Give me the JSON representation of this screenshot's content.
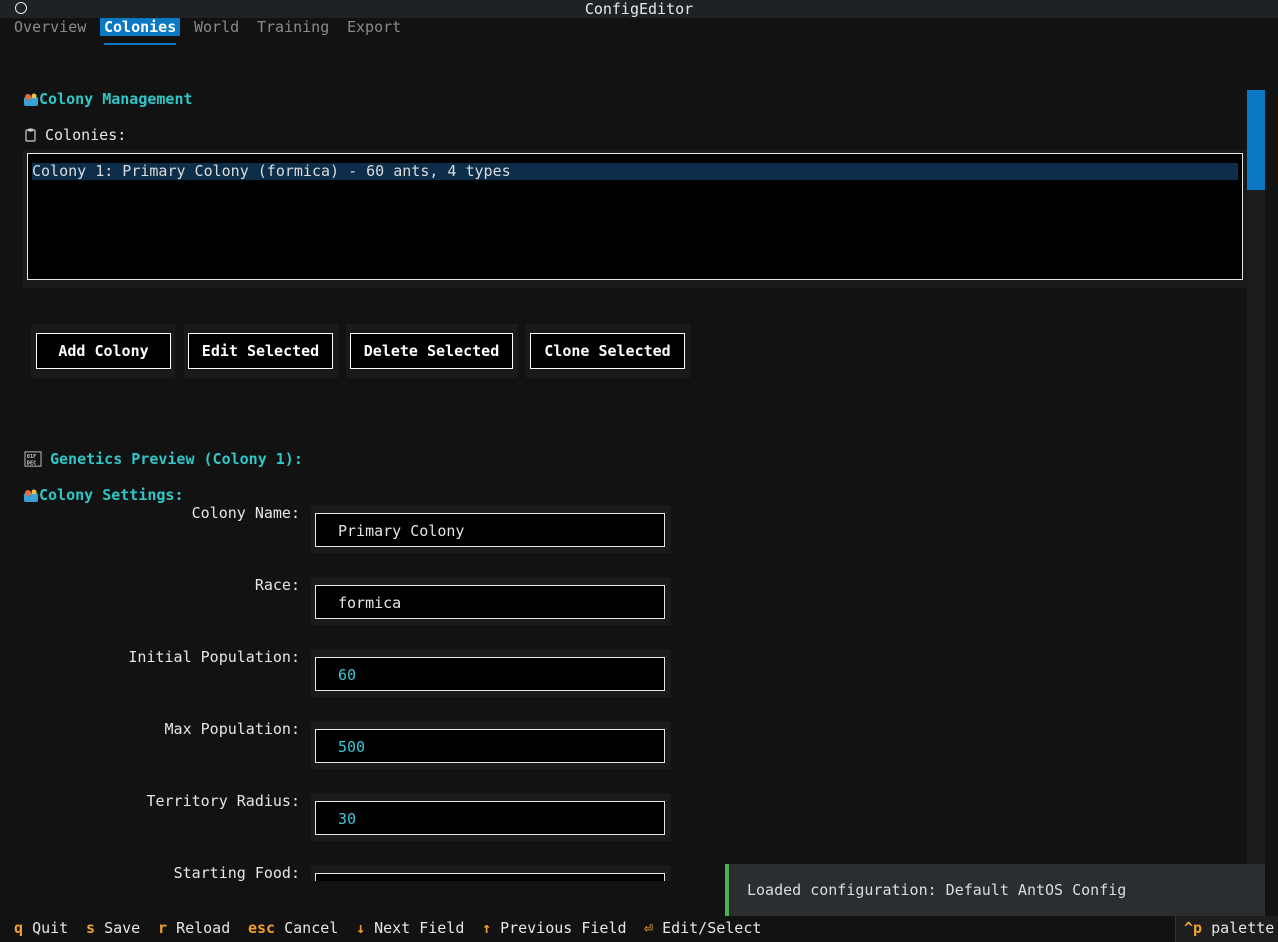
{
  "window": {
    "title": "ConfigEditor"
  },
  "tabs": [
    {
      "label": "Overview"
    },
    {
      "label": "Colonies"
    },
    {
      "label": "World"
    },
    {
      "label": "Training"
    },
    {
      "label": "Export"
    }
  ],
  "colony_management": {
    "title": "Colony Management",
    "list_label": "Colonies:",
    "items": [
      "Colony 1: Primary Colony (formica) - 60 ants, 4 types"
    ],
    "buttons": {
      "add": "Add Colony",
      "edit": "Edit Selected",
      "delete": "Delete Selected",
      "clone": "Clone Selected"
    }
  },
  "genetics_preview": {
    "title": "Genetics Preview (Colony 1):"
  },
  "colony_settings": {
    "title": "Colony Settings:",
    "fields": [
      {
        "label": "Colony Name:",
        "value": "Primary Colony"
      },
      {
        "label": "Race:",
        "value": "formica"
      },
      {
        "label": "Initial Population:",
        "value": "60"
      },
      {
        "label": "Max Population:",
        "value": "500"
      },
      {
        "label": "Territory Radius:",
        "value": "30"
      },
      {
        "label": "Starting Food:",
        "value": ""
      }
    ]
  },
  "toast": {
    "message": "Loaded configuration: Default AntOS Config"
  },
  "footer": {
    "bindings": [
      {
        "key": "q",
        "label": "Quit"
      },
      {
        "key": "s",
        "label": "Save"
      },
      {
        "key": "r",
        "label": "Reload"
      },
      {
        "key": "esc",
        "label": "Cancel"
      },
      {
        "key": "↓",
        "label": "Next Field"
      },
      {
        "key": "↑",
        "label": "Previous Field"
      },
      {
        "key": "⏎",
        "label": "Edit/Select"
      }
    ],
    "palette": {
      "key": "^p",
      "label": "palette"
    }
  },
  "colors": {
    "accent": "#0a78c2",
    "section_title": "#2ec6c6",
    "key_highlight": "#f0a030",
    "toast_border": "#4caf50",
    "numeric_value": "#3cc8d8"
  },
  "icons": {
    "colony_section": "ant-colony-icon",
    "list": "clipboard-icon",
    "genetics": "binary-data-icon"
  }
}
